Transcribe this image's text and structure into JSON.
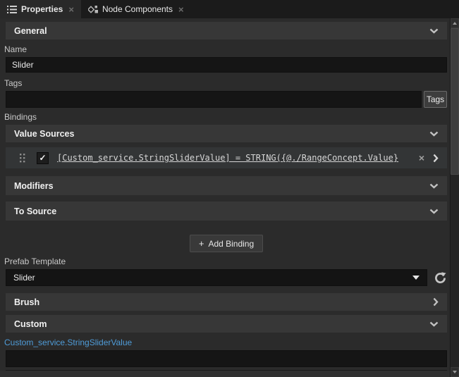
{
  "tab_bar": {
    "tabs": [
      {
        "label": "Properties",
        "icon": "list-icon",
        "close_glyph": "×",
        "active": true
      },
      {
        "label": "Node Components",
        "icon": "node-components-icon",
        "close_glyph": "×",
        "active": false
      }
    ]
  },
  "panel": {
    "general": {
      "title": "General"
    },
    "name_field": {
      "label": "Name",
      "value": "Slider"
    },
    "tags_field": {
      "label": "Tags",
      "value": "",
      "button_label": "Tags"
    },
    "bindings": {
      "label": "Bindings",
      "value_sources": {
        "title": "Value Sources"
      },
      "binding_row": {
        "checked": true,
        "check_glyph": "✓",
        "expression": "[Custom_service.StringSliderValue] = STRING({@./RangeConcept.Value}",
        "remove_glyph": "×"
      },
      "modifiers": {
        "title": "Modifiers"
      },
      "to_source": {
        "title": "To Source"
      },
      "add_button": {
        "plus_glyph": "+",
        "label": "Add Binding"
      }
    },
    "prefab_template": {
      "label": "Prefab Template",
      "value": "Slider",
      "reset_icon": "revert-arrow-icon"
    },
    "brush": {
      "title": "Brush"
    },
    "custom": {
      "title": "Custom",
      "property_link": "Custom_service.StringSliderValue",
      "value": ""
    }
  },
  "colors": {
    "panel_bg": "#2b2b2b",
    "tabbar_bg": "#1b1b1b",
    "section_header_bg": "#373737",
    "input_bg": "#151515",
    "link_blue": "#4f9cd8"
  }
}
